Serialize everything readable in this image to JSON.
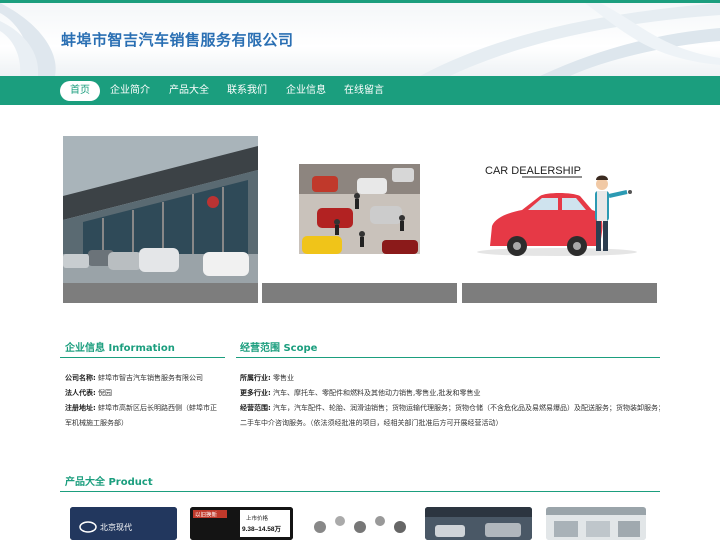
{
  "site": {
    "company_name": "蚌埠市智吉汽车销售服务有限公司"
  },
  "nav": {
    "items": [
      {
        "label": "首页",
        "active": true
      },
      {
        "label": "企业简介",
        "active": false
      },
      {
        "label": "产品大全",
        "active": false
      },
      {
        "label": "联系我们",
        "active": false
      },
      {
        "label": "企业信息",
        "active": false
      },
      {
        "label": "在线留言",
        "active": false
      }
    ]
  },
  "gallery": {
    "banner3_text": "CAR DEALERSHIP"
  },
  "company_info": {
    "title": "企业信息 Information",
    "rows": [
      {
        "label": "公司名称:",
        "value": "蚌埠市智吉汽车销售服务有限公司"
      },
      {
        "label": "法人代表:",
        "value": "倪园"
      },
      {
        "label": "注册地址:",
        "value": "蚌埠市高新区后长明路西侧（蚌埠市正",
        "value2": "军机械施工服务部）"
      }
    ]
  },
  "scope": {
    "title": "经营范围 Scope",
    "rows": [
      {
        "label": "所属行业:",
        "value": "零售业"
      },
      {
        "label": "更多行业:",
        "value": "汽车、摩托车、零配件和燃料及其他动力销售,零售业,批发和零售业"
      },
      {
        "label": "经营范围:",
        "value": "汽车，汽车配件、轮胎、润滑油销售；货物运输代理服务；货物仓储（不含危化品及易燃易爆品）及配送服务；货物装卸服务；",
        "value2": "二手车中介咨询服务。（依法须经批准的项目，经相关部门批准后方可开展经营活动）"
      }
    ]
  },
  "products": {
    "title": "产品大全 Product",
    "thumb1_text": "北京现代",
    "thumb2_badge": "以旧换新",
    "thumb2_text": "上市价格",
    "thumb2_price": "9.38–14.58万"
  },
  "colors": {
    "accent": "#1b9e7e",
    "title_blue": "#2a6fb3",
    "caption_gray": "#7d7d7d"
  }
}
